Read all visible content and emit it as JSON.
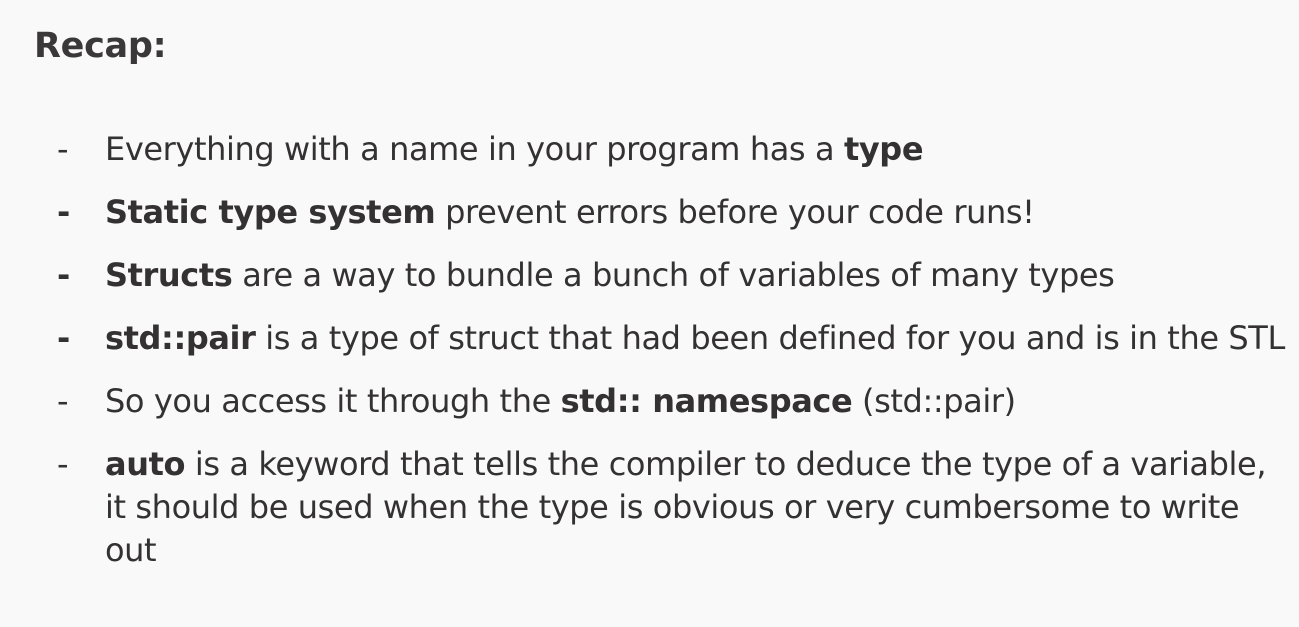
{
  "title": "Recap:",
  "bullets": [
    {
      "dash": "-",
      "bold_dash": false,
      "parts": [
        {
          "text": "Everything with a name in your program has a ",
          "bold": false
        },
        {
          "text": "type",
          "bold": true
        }
      ]
    },
    {
      "dash": "-",
      "bold_dash": true,
      "parts": [
        {
          "text": "Static type system",
          "bold": true
        },
        {
          "text": " prevent errors before your code runs!",
          "bold": false
        }
      ]
    },
    {
      "dash": "-",
      "bold_dash": true,
      "parts": [
        {
          "text": "Structs",
          "bold": true
        },
        {
          "text": " are a way to bundle a bunch of variables of many types",
          "bold": false
        }
      ]
    },
    {
      "dash": "-",
      "bold_dash": true,
      "parts": [
        {
          "text": "std::pair",
          "bold": true
        },
        {
          "text": " is a type of struct that had been defined for you and is in the STL",
          "bold": false
        }
      ]
    },
    {
      "dash": "-",
      "bold_dash": false,
      "parts": [
        {
          "text": "So you access it through the ",
          "bold": false
        },
        {
          "text": "std:: namespace",
          "bold": true
        },
        {
          "text": " (std::pair)",
          "bold": false
        }
      ]
    },
    {
      "dash": "-",
      "bold_dash": false,
      "parts": [
        {
          "text": "auto",
          "bold": true
        },
        {
          "text": " is a keyword that tells the compiler to deduce the type of a variable, it should be used when the type is obvious or very cumbersome to write out",
          "bold": false
        }
      ]
    }
  ]
}
